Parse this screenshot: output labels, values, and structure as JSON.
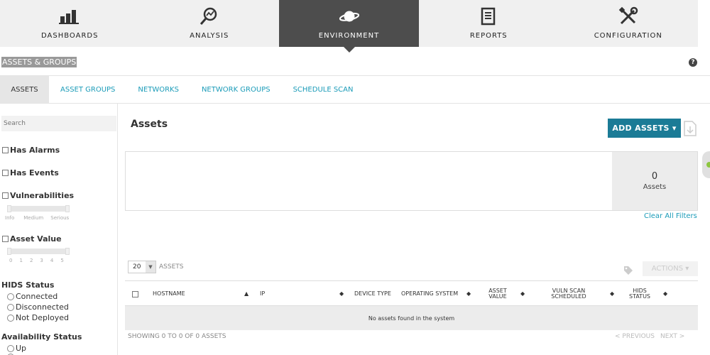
{
  "nav": {
    "tabs": [
      {
        "label": "DASHBOARDS",
        "icon": "bar-chart-icon"
      },
      {
        "label": "ANALYSIS",
        "icon": "magnifier-icon"
      },
      {
        "label": "ENVIRONMENT",
        "icon": "planet-icon",
        "active": true
      },
      {
        "label": "REPORTS",
        "icon": "document-icon"
      },
      {
        "label": "CONFIGURATION",
        "icon": "tools-icon"
      }
    ]
  },
  "page": {
    "title": "ASSETS & GROUPS",
    "help": "?"
  },
  "subtabs": [
    "ASSETS",
    "ASSET GROUPS",
    "NETWORKS",
    "NETWORK GROUPS",
    "SCHEDULE SCAN"
  ],
  "sidebar": {
    "search_placeholder": "Search",
    "filters": {
      "has_alarms": "Has Alarms",
      "has_events": "Has Events",
      "vulnerabilities": "Vulnerabilities",
      "vuln_levels": [
        "Info",
        "Medium",
        "Serious"
      ],
      "asset_value": "Asset Value",
      "asset_values": [
        "0",
        "1",
        "2",
        "3",
        "4",
        "5"
      ]
    },
    "hids": {
      "title": "HIDS Status",
      "options": [
        "Connected",
        "Disconnected",
        "Not Deployed"
      ]
    },
    "availability": {
      "title": "Availability Status",
      "options": [
        "Up"
      ]
    }
  },
  "main": {
    "title": "Assets",
    "add_button": "ADD ASSETS ▾",
    "count": "0",
    "count_label": "Assets",
    "clear_filters": "Clear All Filters",
    "page_size": "20",
    "page_size_suffix": "ASSETS",
    "actions_label": "ACTIONS ▾",
    "columns": [
      "HOSTNAME",
      "IP",
      "DEVICE TYPE",
      "OPERATING SYSTEM",
      "ASSET VALUE",
      "VULN SCAN SCHEDULED",
      "HIDS STATUS"
    ],
    "empty_message": "No assets found in the system",
    "showing": "SHOWING 0 TO 0 OF 0 ASSETS",
    "prev": "< PREVIOUS",
    "next": "NEXT >"
  },
  "colors": {
    "accent": "#1b7b96",
    "link": "#1a9bb8",
    "nav_active": "#4d4d4d"
  }
}
